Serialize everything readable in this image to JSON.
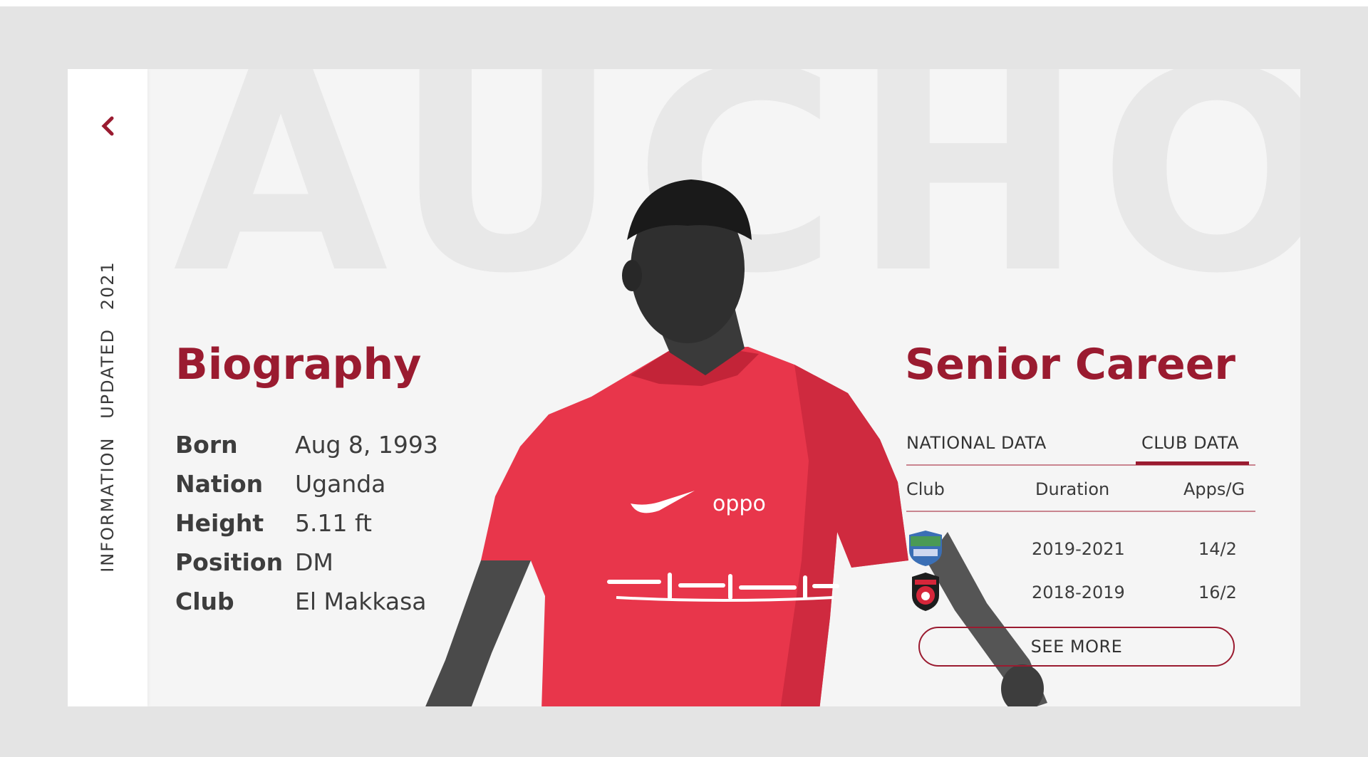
{
  "sidebar": {
    "back_icon": "chevron-left-icon",
    "vertical_text": [
      "INFORMATION",
      "UPDATED",
      "2021"
    ]
  },
  "background_name": "AUCHO",
  "biography": {
    "title": "Biography",
    "rows": [
      {
        "label": "Born",
        "value": "Aug 8, 1993"
      },
      {
        "label": "Nation",
        "value": "Uganda"
      },
      {
        "label": "Height",
        "value": "5.11 ft"
      },
      {
        "label": "Position",
        "value": "DM"
      },
      {
        "label": "Club",
        "value": "El Makkasa"
      }
    ]
  },
  "player_shirt": {
    "sponsor": "oppo"
  },
  "career": {
    "title": "Senior Career",
    "tabs": [
      {
        "label": "NATIONAL DATA",
        "active": false
      },
      {
        "label": "CLUB DATA",
        "active": true
      }
    ],
    "columns": [
      "Club",
      "Duration",
      "Apps/G"
    ],
    "rows": [
      {
        "crest": "club-crest-icon",
        "duration": "2019-2021",
        "apps": "14/2"
      },
      {
        "crest": "club-crest-icon",
        "duration": "2018-2019",
        "apps": "16/2"
      }
    ],
    "see_more": "SEE MORE"
  },
  "colors": {
    "accent": "#9a1b30",
    "background": "#e4e4e4",
    "card": "#f5f5f5",
    "jersey": "#e8364b"
  }
}
